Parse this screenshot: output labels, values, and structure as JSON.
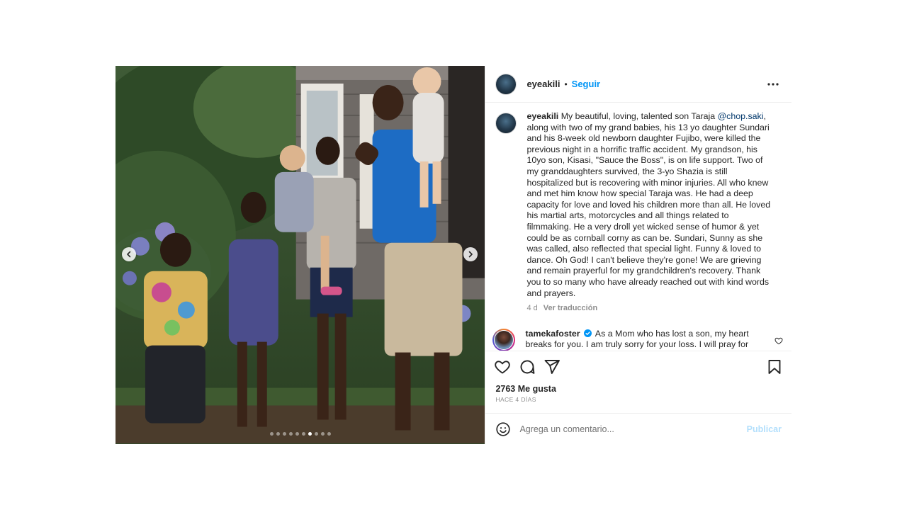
{
  "post": {
    "username": "eyeakili",
    "separator": "•",
    "follow_label": "Seguir",
    "caption": {
      "username": "eyeakili",
      "text_before_mention": " My beautiful, loving, talented son Taraja ",
      "mention": "@chop.saki",
      "text_after_mention": ", along with two of my grand babies, his 13 yo daughter Sundari and his 8-week old newborn daughter Fujibo, were killed the previous night in a horrific traffic accident. My grandson, his 10yo son, Kisasi, \"Sauce the Boss\", is on life support. Two of my granddaughters survived, the 3-yo Shazia is still hospitalized but is recovering with minor injuries. All who knew and met him know how special Taraja was. He had a deep capacity for love and loved his children more than all. He loved his martial arts, motorcycles and all things related to filmmaking. He a very droll yet wicked sense of humor & yet could be as cornball corny as can be. Sundari, Sunny as she was called, also reflected that special light. Funny & loved to dance. Oh God! I can't believe they're gone! We are grieving and remain prayerful for my grandchildren's recovery. Thank you to so many who have already reached out with kind words and prayers.",
      "time": "4 d",
      "translate_label": "Ver traducción"
    },
    "comments": [
      {
        "username": "tamekafoster",
        "verified": true,
        "text": " As a Mom who has lost a son, my heart breaks for you. I am truly sorry for your loss. I will pray for"
      }
    ],
    "likes": "2763 Me gusta",
    "posted_ago": "HACE 4 DÍAS",
    "add_comment_placeholder": "Agrega un comentario...",
    "publish_label": "Publicar",
    "carousel": {
      "total_slides": 10,
      "active_index": 6
    }
  },
  "icons": {
    "prev": "chevron-left-icon",
    "next": "chevron-right-icon",
    "more": "more-horizontal-icon",
    "like": "heart-icon",
    "comment": "comment-icon",
    "share": "share-icon",
    "save": "bookmark-icon",
    "emoji": "emoji-icon",
    "verified": "verified-badge-icon"
  },
  "colors": {
    "link_blue": "#0095f6",
    "mention_blue": "#00376b",
    "muted_gray": "#8e8e8e",
    "publish_disabled": "#b2dffc",
    "verified_blue": "#0095f6"
  }
}
